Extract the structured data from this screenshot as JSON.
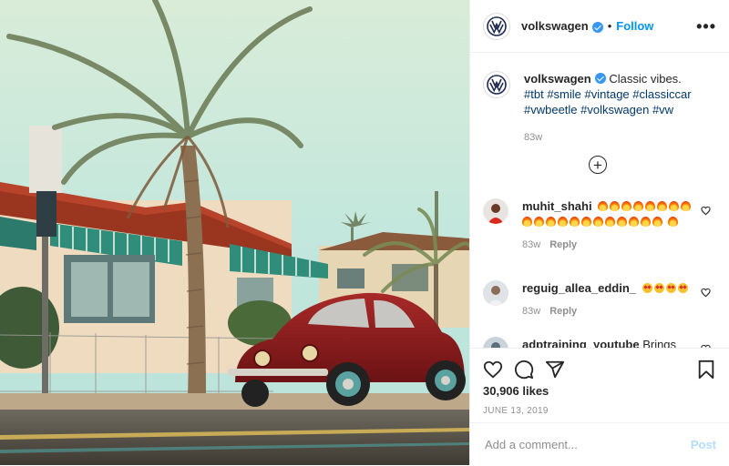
{
  "header": {
    "username": "volkswagen",
    "separator": "•",
    "follow_label": "Follow",
    "more_label": "•••",
    "verified_icon": "verified-badge-icon",
    "logo_icon": "vw-logo-icon"
  },
  "caption": {
    "username": "volkswagen",
    "text": "Classic vibes.",
    "hashtags": [
      "#tbt",
      "#smile",
      "#vintage",
      "#classiccar",
      "#vwbeetle",
      "#volkswagen",
      "#vw"
    ],
    "time": "83w"
  },
  "load_more_icon": "plus-circle-icon",
  "comments": [
    {
      "username": "muhit_shahi",
      "emoji": "fire",
      "emoji_count": 21,
      "time": "83w",
      "reply_label": "Reply"
    },
    {
      "username": "reguig_allea_eddin_",
      "emoji": "star-struck",
      "emoji_count": 4,
      "time": "83w",
      "reply_label": "Reply"
    },
    {
      "username": "adptraining_youtube",
      "text": "Brings back",
      "partial": true
    }
  ],
  "actions": {
    "like_icon": "heart-icon",
    "comment_icon": "comment-icon",
    "share_icon": "share-icon",
    "save_icon": "bookmark-icon",
    "likes": "30,906 likes",
    "date": "JUNE 13, 2019"
  },
  "add_comment": {
    "placeholder": "Add a comment...",
    "post_label": "Post"
  },
  "colors": {
    "accent": "#0095f6",
    "verified": "#3897f0",
    "post_disabled": "#b3dbff",
    "text_secondary": "#8e8e8e",
    "car_red": "#8e1a1c",
    "sky": "#bfe6dc"
  }
}
